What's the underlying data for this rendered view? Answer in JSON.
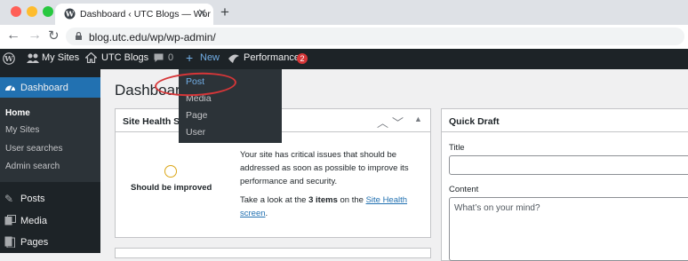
{
  "browser": {
    "tab_title": "Dashboard ‹ UTC Blogs — Wor",
    "url": "blog.utc.edu/wp/wp-admin/"
  },
  "adminbar": {
    "my_sites": "My Sites",
    "site_name": "UTC Blogs",
    "comments_count": "0",
    "new_label": "New",
    "performance_label": "Performance",
    "performance_badge": "2"
  },
  "new_menu": {
    "items": [
      "Post",
      "Media",
      "Page",
      "User"
    ]
  },
  "sidebar": {
    "dashboard_label": "Dashboard",
    "sub_items": [
      "Home",
      "My Sites",
      "User searches",
      "Admin search"
    ],
    "items": [
      "Posts",
      "Media",
      "Pages"
    ]
  },
  "main": {
    "page_title": "Dashboard",
    "site_health": {
      "title": "Site Health S",
      "status": "Should be improved",
      "message": "Your site has critical issues that should be addressed as soon as possible to improve its performance and security.",
      "take_look_prefix": "Take a look at the ",
      "items_text": "3 items",
      "on_the": " on the ",
      "link_text": "Site Health screen",
      "period": "."
    },
    "quick_draft": {
      "title": "Quick Draft",
      "title_label": "Title",
      "content_label": "Content",
      "content_placeholder": "What’s on your mind?"
    }
  },
  "colors": {
    "admin_bar": "#1d2327",
    "active_blue": "#2271b1",
    "annotation_red": "#d63638"
  }
}
